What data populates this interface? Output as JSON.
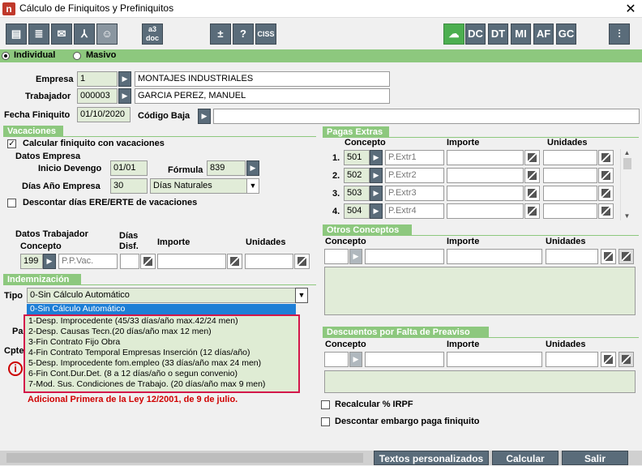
{
  "window": {
    "title": "Cálculo de Finiquitos y Prefiniquitos",
    "close": "✕"
  },
  "toolbar": {
    "a3doc": "a3\ndoc",
    "plusminus": "±",
    "help": "?",
    "ciss": "CISS",
    "dc": "DC",
    "dt": "DT",
    "mi": "MI",
    "af": "AF",
    "gc": "GC"
  },
  "mode": {
    "individual": "Individual",
    "masivo": "Masivo",
    "selected": "Individual"
  },
  "empresa": {
    "label": "Empresa",
    "code": "1",
    "name": "MONTAJES INDUSTRIALES"
  },
  "trabajador": {
    "label": "Trabajador",
    "code": "000003",
    "name": "GARCIA PEREZ, MANUEL"
  },
  "fecha": {
    "label": "Fecha Finiquito",
    "value": "01/10/2020"
  },
  "codigo_baja": {
    "label": "Código Baja",
    "value": ""
  },
  "vacaciones": {
    "title": "Vacaciones",
    "calcular": "Calcular finiquito con vacaciones",
    "datos_empresa": "Datos Empresa",
    "inicio_devengo_label": "Inicio Devengo",
    "inicio_devengo": "01/01",
    "formula_label": "Fórmula",
    "formula": "839",
    "dias_anio_label": "Días Año Empresa",
    "dias_anio": "30",
    "dias_tipo": "Días Naturales",
    "descontar": "Descontar días ERE/ERTE de vacaciones",
    "datos_trabajador": "Datos Trabajador",
    "concepto_label": "Concepto",
    "dias_label_1": "Días",
    "dias_label_2": "Disf.",
    "importe_label": "Importe",
    "unidades_label": "Unidades",
    "concepto_code": "199",
    "concepto_desc": "P.P.Vac."
  },
  "indemnizacion": {
    "title": "Indemnización",
    "tipo_label": "Tipo",
    "tipo_value": "0-Sin Cálculo Automático",
    "hidden_label_1": "Pa",
    "hidden_label_2": "Cpte",
    "options": [
      "0-Sin Cálculo Automático",
      "1-Desp. Improcedente (45/33 días/año max.42/24 men)",
      "2-Desp. Causas Tecn.(20 días/año max 12 men)",
      "3-Fin Contrato Fijo Obra",
      "4-Fin Contrato Temporal Empresas Inserción (12 días/año)",
      "5-Desp. Improcedente fom.empleo (33 días/año max 24 men)",
      "6-Fin Cont.Dur.Det. (8 a 12 días/año o segun convenio)",
      "7-Mod. Sus. Condiciones de Trabajo. (20 días/año max 9 men)"
    ],
    "note": "Adicional Primera de la Ley 12/2001, de 9 de julio."
  },
  "pagas_extras": {
    "title": "Pagas Extras",
    "concepto": "Concepto",
    "importe": "Importe",
    "unidades": "Unidades",
    "rows": [
      {
        "n": "1.",
        "code": "501",
        "desc": "P.Extr1"
      },
      {
        "n": "2.",
        "code": "502",
        "desc": "P.Extr2"
      },
      {
        "n": "3.",
        "code": "503",
        "desc": "P.Extr3"
      },
      {
        "n": "4.",
        "code": "504",
        "desc": "P.Extr4"
      }
    ]
  },
  "otros": {
    "title": "Otros Conceptos",
    "concepto": "Concepto",
    "importe": "Importe",
    "unidades": "Unidades"
  },
  "descuentos": {
    "title": "Descuentos por Falta de Preaviso",
    "concepto": "Concepto",
    "importe": "Importe",
    "unidades": "Unidades"
  },
  "recalcular": "Recalcular % IRPF",
  "descontar_embargo": "Descontar embargo paga finiquito",
  "buttons": {
    "textos": "Textos personalizados",
    "calcular": "Calcular",
    "salir": "Salir"
  }
}
